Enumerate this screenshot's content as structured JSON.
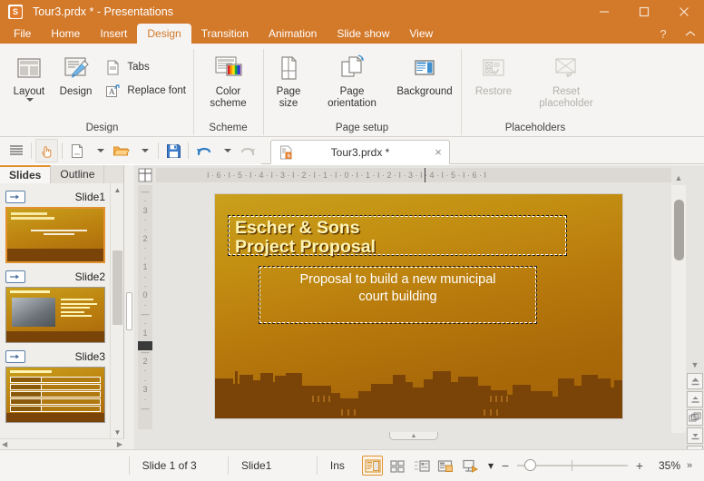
{
  "titlebar": {
    "app_initial": "S",
    "title": "Tour3.prdx * - Presentations",
    "minimize": "minimize-icon",
    "maximize": "maximize-icon",
    "close": "close-icon"
  },
  "tabs": [
    {
      "label": "File",
      "active": false
    },
    {
      "label": "Home",
      "active": false
    },
    {
      "label": "Insert",
      "active": false
    },
    {
      "label": "Design",
      "active": true
    },
    {
      "label": "Transition",
      "active": false
    },
    {
      "label": "Animation",
      "active": false
    },
    {
      "label": "Slide show",
      "active": false
    },
    {
      "label": "View",
      "active": false
    }
  ],
  "tabbar_right": {
    "help": "?",
    "collapse": "chevron-up-icon"
  },
  "ribbon": {
    "groups": [
      {
        "name": "Design",
        "label": "Design",
        "big_buttons": [
          {
            "label": "Layout",
            "has_caret": true,
            "disabled": false
          },
          {
            "label": "Design",
            "has_caret": false,
            "disabled": false
          }
        ],
        "small_buttons": [
          {
            "label": "Tabs",
            "disabled": false
          },
          {
            "label": "Replace font",
            "disabled": false
          }
        ]
      },
      {
        "name": "Scheme",
        "label": "Scheme",
        "big_buttons": [
          {
            "label": "Color\nscheme",
            "has_caret": true,
            "disabled": false
          }
        ],
        "small_buttons": []
      },
      {
        "name": "Page setup",
        "label": "Page setup",
        "big_buttons": [
          {
            "label": "Page\nsize",
            "has_caret": true,
            "disabled": false
          },
          {
            "label": "Page\norientation",
            "has_caret": true,
            "disabled": false
          },
          {
            "label": "Background",
            "has_caret": false,
            "disabled": false
          }
        ],
        "small_buttons": []
      },
      {
        "name": "Placeholders",
        "label": "Placeholders",
        "big_buttons": [
          {
            "label": "Restore",
            "has_caret": false,
            "disabled": true
          },
          {
            "label": "Reset\nplaceholder",
            "has_caret": true,
            "disabled": true
          }
        ],
        "small_buttons": []
      }
    ]
  },
  "quick_access": {
    "buttons": [
      "menu-icon",
      "hand-pointer-icon",
      "new-document-icon",
      "new-document-caret",
      "open-folder-icon",
      "open-folder-caret",
      "save-icon",
      "undo-icon",
      "undo-caret",
      "redo-icon",
      "redo-caret",
      "more-icon"
    ]
  },
  "document_tab": {
    "label": "Tour3.prdx *",
    "close": "×"
  },
  "left_panel": {
    "tabs": [
      {
        "label": "Slides",
        "active": true
      },
      {
        "label": "Outline",
        "active": false
      }
    ],
    "slides": [
      {
        "name": "Slide1",
        "selected": true,
        "title": "Escher & Sons\nProject Proposal",
        "subtitle": "Proposal to build a new municipal\ncourt building"
      },
      {
        "name": "Slide2",
        "selected": false,
        "title": "Important Facts",
        "bullets": [
          "existing problem",
          "developing solution",
          "architect rating",
          "time line",
          "cost of things"
        ]
      },
      {
        "name": "Slide3",
        "selected": false,
        "title": "Proposed Time line",
        "rows": [
          [
            "JAN - FEB 2005",
            "background research"
          ],
          [
            "2005",
            "land acquisition survey"
          ],
          [
            "MAR - MAY 2005",
            "evaluation"
          ],
          [
            "JUN - SEP 2005",
            "capital investment"
          ],
          [
            "2006",
            "bid facility"
          ]
        ]
      }
    ]
  },
  "ruler": {
    "horizontal_marks": "I  ·  6  ·  I  ·  5  ·  I  ·  4  ·  I  ·  3  ·  I  ·  2  ·  I  ·  1  ·  I  ·  0  ·  I  ·  1  ·  I  ·  2  ·  I  ·  3  ·  I  ·  4  ·  I  ·  5  ·  I  ·  6  ·  I",
    "vertical_marks": [
      "—",
      "·",
      "3",
      "·",
      "·",
      "2",
      "·",
      "·",
      "1",
      "·",
      "·",
      "0",
      "·",
      "—",
      "·",
      "1",
      "·",
      "—",
      "2",
      "·",
      "·",
      "3",
      "·",
      "—"
    ]
  },
  "slide_editor": {
    "title_text": "Escher & Sons\nProject Proposal",
    "subtitle_text": "Proposal to build a new municipal\ncourt building"
  },
  "statusbar": {
    "slide_counter": "Slide 1 of 3",
    "layout_name": "Slide1",
    "insert_mode": "Ins",
    "view_buttons": [
      {
        "name": "normal-view",
        "active": true
      },
      {
        "name": "slide-sorter-view",
        "active": false
      },
      {
        "name": "outline-view",
        "active": false
      },
      {
        "name": "notes-view",
        "active": false
      },
      {
        "name": "slide-show-view",
        "active": false
      }
    ],
    "view_caret": "▾",
    "zoom_out": "−",
    "zoom_in": "+",
    "zoom_value": "35%",
    "more": "»"
  },
  "colors": {
    "accent": "#d3792a",
    "ribbon_bg": "#f5f4f2",
    "slide_sky_top": "#c9a01c",
    "slide_sky_bottom": "#a36107",
    "city": "#7a4408",
    "title_text": "#fdf3b3",
    "selected_border": "#e1922f"
  }
}
